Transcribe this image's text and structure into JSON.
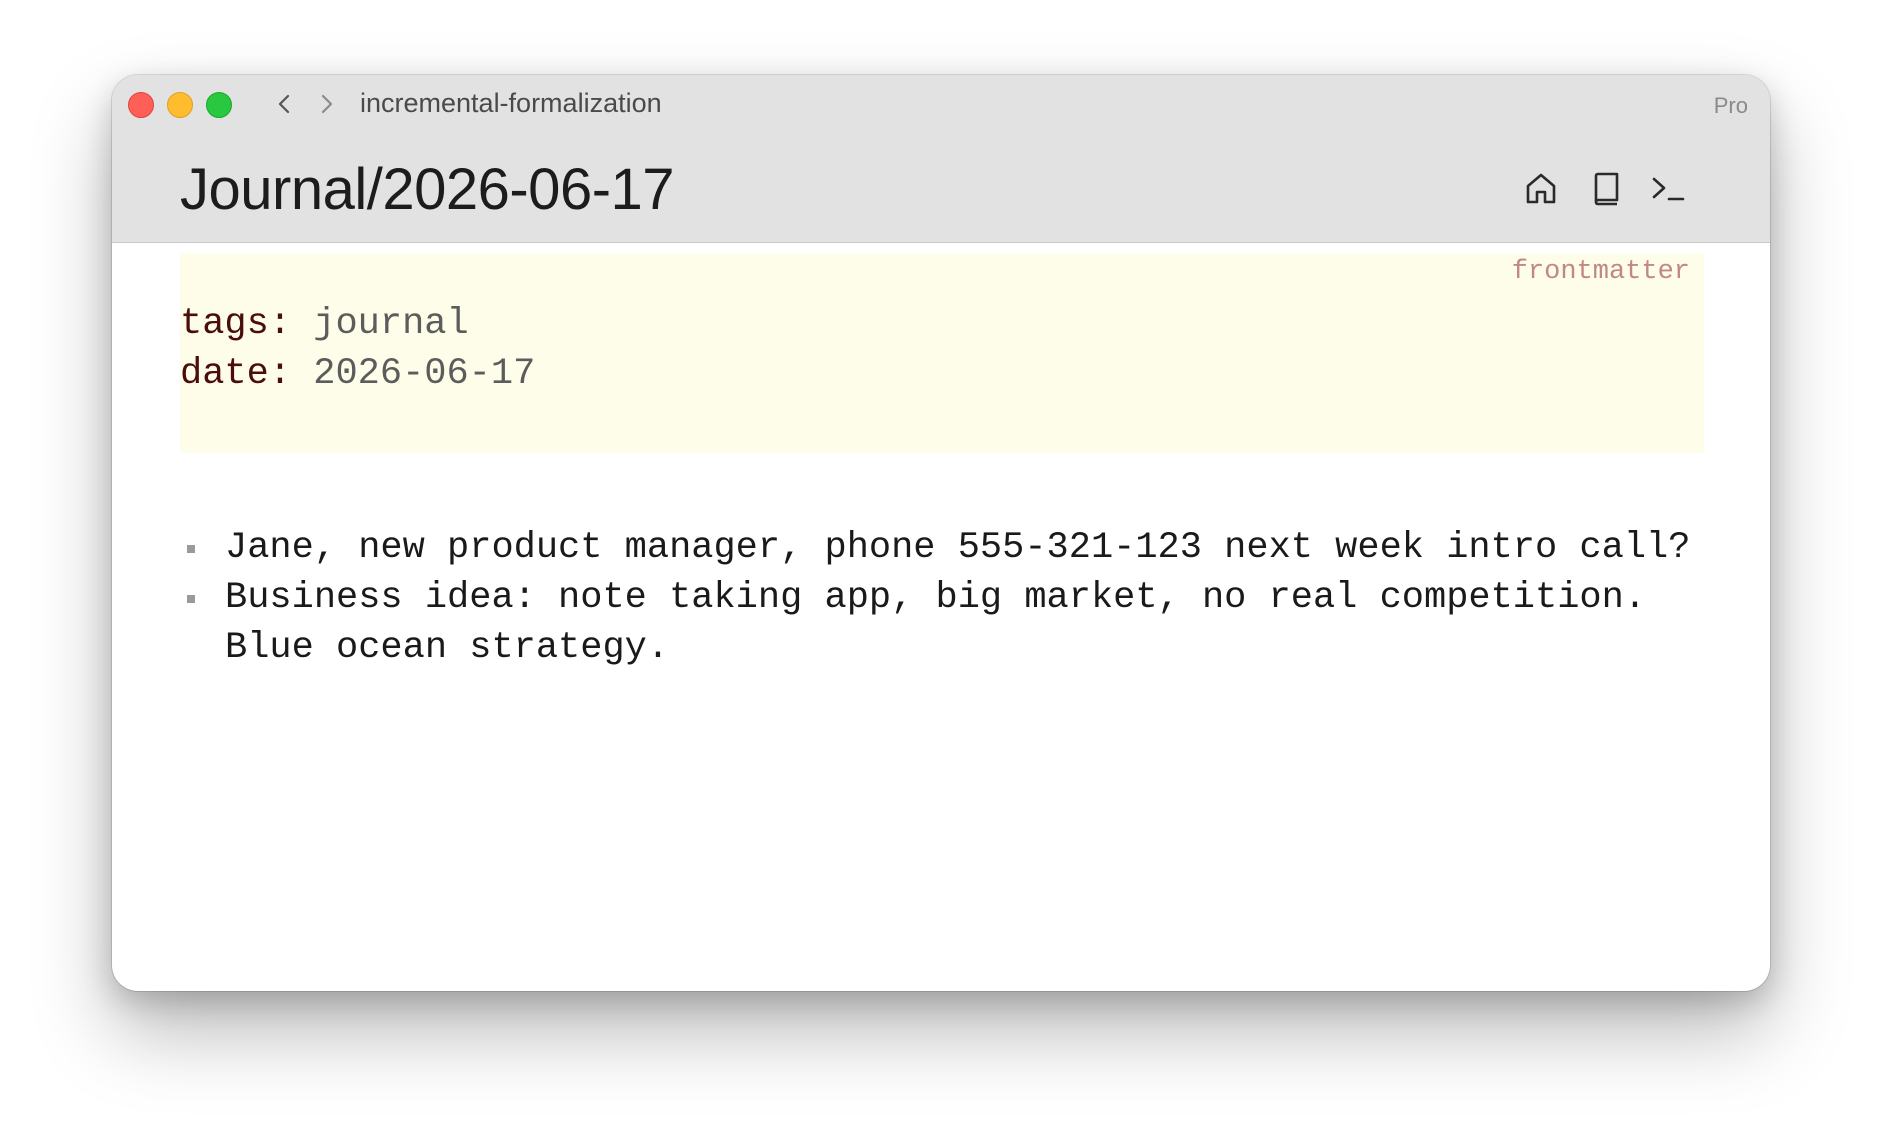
{
  "window": {
    "breadcrumb": "incremental-formalization",
    "plan_label": "Pro",
    "title": "Journal/2026-06-17"
  },
  "toolbar": {
    "icons": [
      "home-icon",
      "book-icon",
      "terminal-icon"
    ]
  },
  "frontmatter": {
    "label": "frontmatter",
    "fields": [
      {
        "key": "tags:",
        "value": "journal"
      },
      {
        "key": "date:",
        "value": "2026-06-17"
      }
    ]
  },
  "notes": {
    "items": [
      {
        "text": "Jane, new product manager, phone 555-321-123 next week intro call?"
      },
      {
        "text": "Business idea: note taking app, big market, no real competition. Blue ocean strategy."
      }
    ]
  },
  "colors": {
    "titlebar_bg": "#e2e2e2",
    "frontmatter_bg": "#fefde9",
    "frontmatter_key": "#4a0d0d",
    "frontmatter_label": "#c08a84",
    "close": "#fe5f57",
    "minimize": "#febc2e",
    "maximize": "#28c840"
  }
}
